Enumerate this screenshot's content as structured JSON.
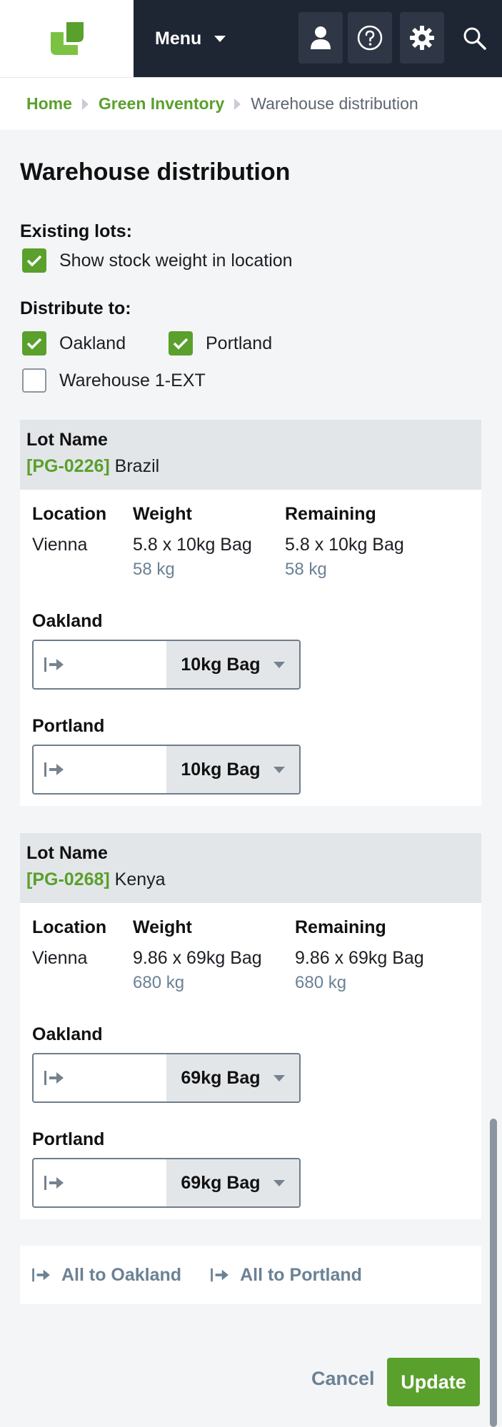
{
  "header": {
    "menu_label": "Menu",
    "icons": [
      "profile-icon",
      "help-icon",
      "settings-icon",
      "search-icon"
    ],
    "brand_color": "#5aa02c",
    "nav_color": "#1e2533"
  },
  "breadcrumb": {
    "home": "Home",
    "section": "Green Inventory",
    "current": "Warehouse distribution"
  },
  "page": {
    "title": "Warehouse distribution"
  },
  "existing_lots": {
    "label": "Existing lots:",
    "show_stock_weight": {
      "label": "Show stock weight in location",
      "checked": true
    }
  },
  "distribute_to": {
    "label": "Distribute to:",
    "options": [
      {
        "label": "Oakland",
        "checked": true
      },
      {
        "label": "Portland",
        "checked": true
      },
      {
        "label": "Warehouse 1-EXT",
        "checked": false
      }
    ]
  },
  "lots": [
    {
      "head_label": "Lot Name",
      "code": "[PG-0226]",
      "name": "Brazil",
      "columns": {
        "location": "Location",
        "weight": "Weight",
        "remaining": "Remaining"
      },
      "location": "Vienna",
      "weight": "5.8 x 10kg Bag",
      "weight_kg": "58 kg",
      "remaining": "5.8 x 10kg Bag",
      "remaining_kg": "58 kg",
      "destinations": [
        {
          "label": "Oakland",
          "value": "",
          "unit": "10kg Bag"
        },
        {
          "label": "Portland",
          "value": "",
          "unit": "10kg Bag"
        }
      ]
    },
    {
      "head_label": "Lot Name",
      "code": "[PG-0268]",
      "name": "Kenya",
      "columns": {
        "location": "Location",
        "weight": "Weight",
        "remaining": "Remaining"
      },
      "location": "Vienna",
      "weight": "9.86 x 69kg Bag",
      "weight_kg": "680 kg",
      "remaining": "9.86 x 69kg Bag",
      "remaining_kg": "680 kg",
      "destinations": [
        {
          "label": "Oakland",
          "value": "",
          "unit": "69kg Bag"
        },
        {
          "label": "Portland",
          "value": "",
          "unit": "69kg Bag"
        }
      ]
    }
  ],
  "actions": {
    "all_to_oakland": "All to Oakland",
    "all_to_portland": "All to Portland",
    "cancel": "Cancel",
    "update": "Update"
  }
}
